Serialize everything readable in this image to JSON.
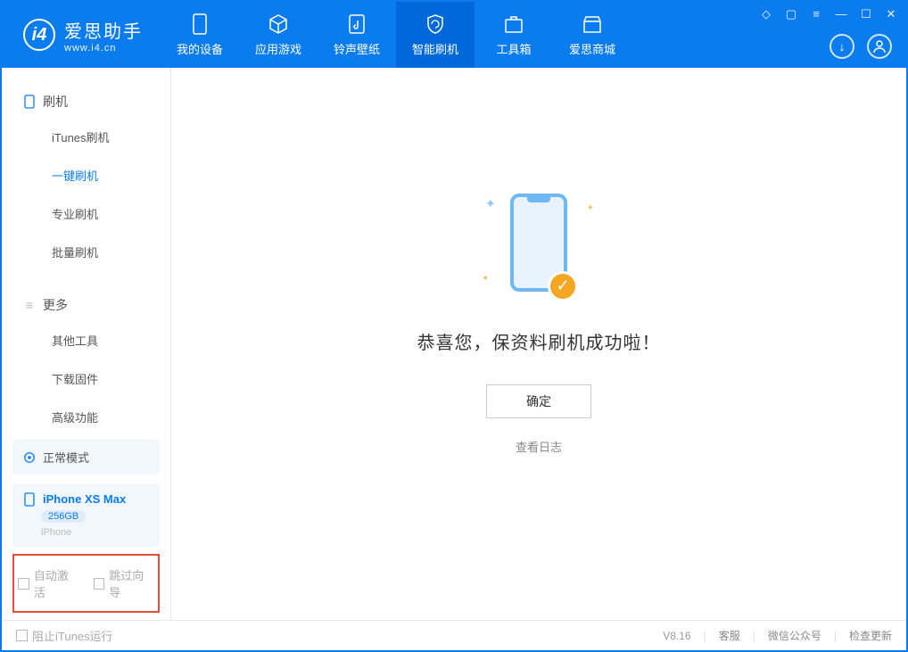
{
  "app": {
    "name": "爱思助手",
    "url": "www.i4.cn"
  },
  "tabs": {
    "device": "我的设备",
    "apps": "应用游戏",
    "ringtones": "铃声壁纸",
    "flash": "智能刷机",
    "toolbox": "工具箱",
    "store": "爱思商城"
  },
  "sidebar": {
    "group_flash": "刷机",
    "items_flash": {
      "itunes": "iTunes刷机",
      "oneclick": "一键刷机",
      "pro": "专业刷机",
      "batch": "批量刷机"
    },
    "group_more": "更多",
    "items_more": {
      "other": "其他工具",
      "firmware": "下载固件",
      "advanced": "高级功能"
    }
  },
  "device_panel": {
    "mode": "正常模式",
    "name": "iPhone XS Max",
    "capacity": "256GB",
    "type": "iPhone"
  },
  "checkboxes": {
    "auto_activate": "自动激活",
    "skip_guide": "跳过向导"
  },
  "content": {
    "success_text": "恭喜您，保资料刷机成功啦！",
    "confirm": "确定",
    "view_log": "查看日志"
  },
  "footer": {
    "block_itunes": "阻止iTunes运行",
    "version": "V8.16",
    "support": "客服",
    "wechat": "微信公众号",
    "update": "检查更新"
  }
}
